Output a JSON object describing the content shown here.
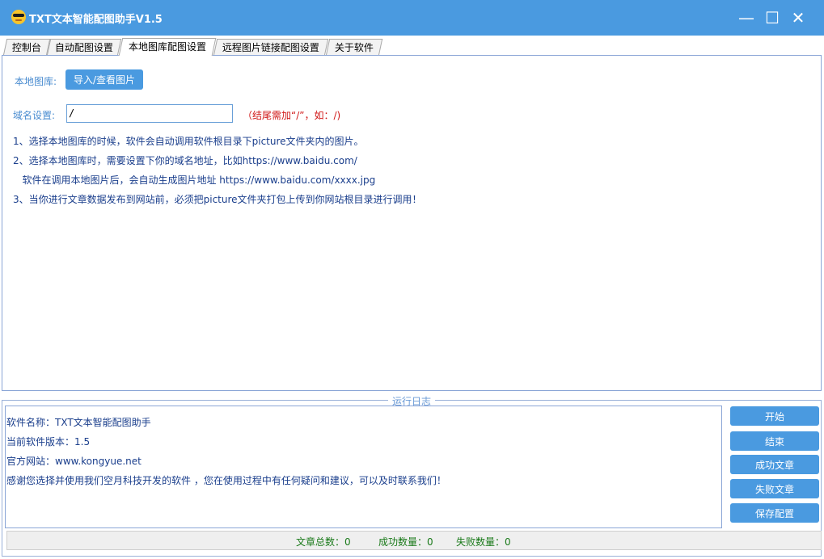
{
  "window": {
    "title": "TXT文本智能配图助手V1.5",
    "minimize_glyph": "—",
    "maximize_glyph": "☐",
    "close_glyph": "✕"
  },
  "tabs": [
    {
      "label": "控制台"
    },
    {
      "label": "自动配图设置"
    },
    {
      "label": "本地图库配图设置"
    },
    {
      "label": "远程图片链接配图设置"
    },
    {
      "label": "关于软件"
    }
  ],
  "active_tab": "本地图库配图设置",
  "local_lib": {
    "label": "本地图库:",
    "button": "导入/查看图片"
  },
  "domain": {
    "label": "域名设置:",
    "value": "/",
    "hint": "（结尾需加“/”，如：/)"
  },
  "instructions": [
    "1、选择本地图库的时候，软件会自动调用软件根目录下picture文件夹内的图片。",
    "2、选择本地图库时，需要设置下你的域名地址，比如https://www.baidu.com/",
    "   软件在调用本地图片后，会自动生成图片地址 https://www.baidu.com/xxxx.jpg",
    "3、当你进行文章数据发布到网站前，必须把picture文件夹打包上传到你网站根目录进行调用！"
  ],
  "log": {
    "title": "运行日志",
    "lines": [
      "软件名称：TXT文本智能配图助手",
      "当前软件版本：1.5",
      "官方网站：www.kongyue.net",
      "感谢您选择并使用我们空月科技开发的软件 ，您在使用过程中有任何疑问和建议，可以及时联系我们！"
    ]
  },
  "actions": {
    "start": "开始",
    "stop": "结束",
    "success_articles": "成功文章",
    "failed_articles": "失败文章",
    "save_config": "保存配置"
  },
  "status": {
    "total": "文章总数：0",
    "success": "成功数量：0",
    "failed": "失败数量：0"
  },
  "colors": {
    "titlebar": "#4a9ae0",
    "button": "#4a9ae0",
    "instruction_text": "#1a3e8c",
    "hint_red": "#d01818",
    "status_green": "#1a7a1a"
  }
}
